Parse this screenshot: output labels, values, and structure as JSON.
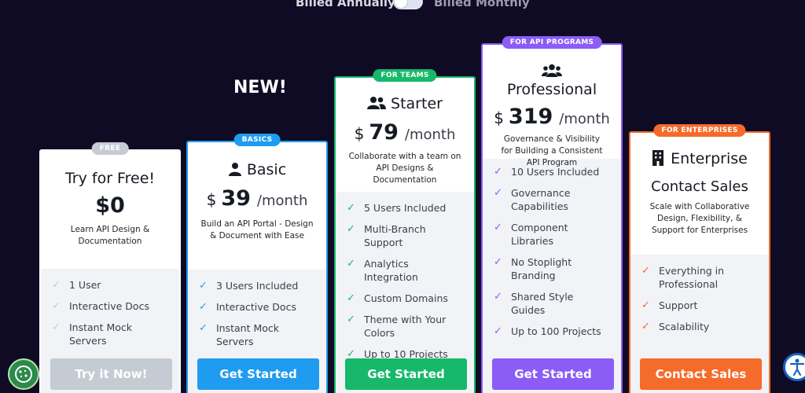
{
  "billing": {
    "annual_label": "Billed Annually",
    "monthly_label": "Billed Monthly"
  },
  "new_label": "NEW!",
  "plans": [
    {
      "badge": "FREE",
      "name": "Try for Free!",
      "price": "$0",
      "description": "Learn API Design & Documentation",
      "features": [
        "1 User",
        "Interactive Docs",
        "Instant Mock Servers"
      ],
      "cta": "Try it Now!"
    },
    {
      "badge": "BASICS",
      "name": "Basic",
      "currency": "$",
      "amount": "39",
      "period": "/month",
      "description": "Build an API Portal - Design & Document with Ease",
      "features": [
        "3 Users Included",
        "Interactive Docs",
        "Instant Mock Servers"
      ],
      "cta": "Get Started"
    },
    {
      "badge": "FOR TEAMS",
      "name": "Starter",
      "currency": "$",
      "amount": "79",
      "period": "/month",
      "description": "Collaborate with a team on API Designs & Documentation",
      "features": [
        "5 Users Included",
        "Multi-Branch Support",
        "Analytics Integration",
        "Custom Domains",
        "Theme with Your Colors",
        "Up to 10 Projects"
      ],
      "cta": "Get Started"
    },
    {
      "badge": "FOR API PROGRAMS",
      "name": "Professional",
      "currency": "$",
      "amount": "319",
      "period": "/month",
      "description": "Governance & Visibility for Building a Consistent API Program",
      "features": [
        "10 Users Included",
        "Governance Capabilities",
        "Component Libraries",
        "No Stoplight Branding",
        "Shared Style Guides",
        "Up to 100 Projects"
      ],
      "cta": "Get Started"
    },
    {
      "badge": "FOR ENTERPRISES",
      "name": "Enterprise",
      "subtitle": "Contact Sales",
      "description": "Scale with Collaborative Design, Flexibility, & Support for Enterprises",
      "features": [
        "Everything in Professional",
        "Support",
        "Scalability"
      ],
      "cta": "Contact Sales"
    }
  ],
  "colors": {
    "background": "#0f0b24",
    "free": "#c5cbd3",
    "basic": "#1f9cf0",
    "starter": "#17b86a",
    "pro": "#8b5cf6",
    "enterprise": "#f56b2a"
  },
  "icons": {
    "basic": "user-icon",
    "starter": "users-icon",
    "pro": "users-group-icon",
    "enterprise": "building-icon",
    "cookie": "cookie-icon",
    "accessibility": "accessibility-icon"
  }
}
